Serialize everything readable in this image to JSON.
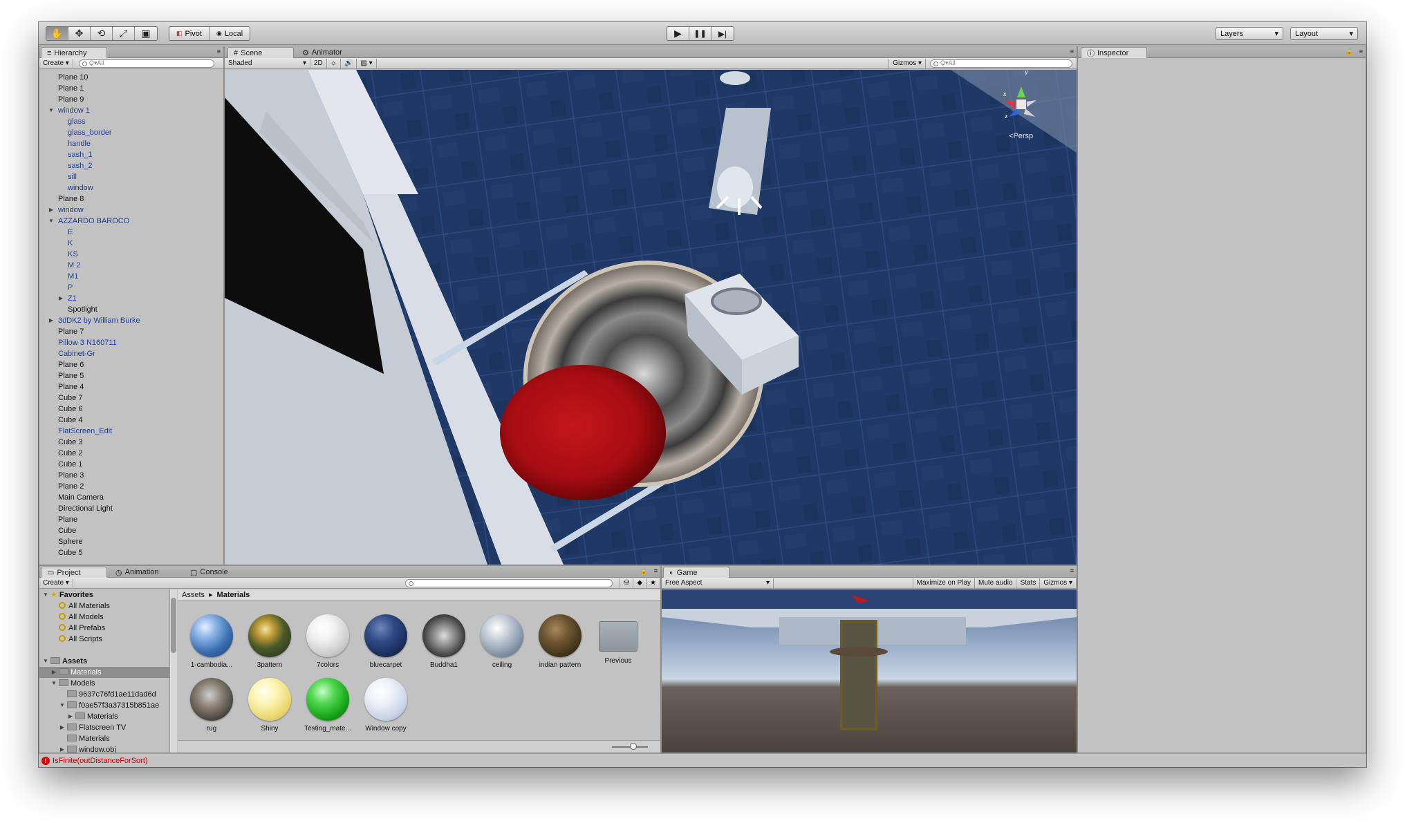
{
  "toolbar": {
    "transform_tools": [
      "hand-tool-icon",
      "move-tool-icon",
      "rotate-tool-icon",
      "scale-tool-icon",
      "rect-tool-icon"
    ],
    "pivot_label": "Pivot",
    "local_label": "Local",
    "play": "▶",
    "pause": "❚❚",
    "step": "▶|",
    "layers_label": "Layers",
    "layout_label": "Layout"
  },
  "hierarchy": {
    "tab": "Hierarchy",
    "create": "Create",
    "search_placeholder": "Q▾All",
    "items": [
      {
        "label": "Plane 10",
        "indent": 0,
        "prefab": false,
        "fold": ""
      },
      {
        "label": "Plane 1",
        "indent": 0,
        "prefab": false,
        "fold": ""
      },
      {
        "label": "Plane 9",
        "indent": 0,
        "prefab": false,
        "fold": ""
      },
      {
        "label": "window 1",
        "indent": 0,
        "prefab": true,
        "fold": "open"
      },
      {
        "label": "glass",
        "indent": 1,
        "prefab": true,
        "fold": ""
      },
      {
        "label": "glass_border",
        "indent": 1,
        "prefab": true,
        "fold": ""
      },
      {
        "label": "handle",
        "indent": 1,
        "prefab": true,
        "fold": ""
      },
      {
        "label": "sash_1",
        "indent": 1,
        "prefab": true,
        "fold": ""
      },
      {
        "label": "sash_2",
        "indent": 1,
        "prefab": true,
        "fold": ""
      },
      {
        "label": "sill",
        "indent": 1,
        "prefab": true,
        "fold": ""
      },
      {
        "label": "window",
        "indent": 1,
        "prefab": true,
        "fold": ""
      },
      {
        "label": "Plane 8",
        "indent": 0,
        "prefab": false,
        "fold": ""
      },
      {
        "label": "window",
        "indent": 0,
        "prefab": true,
        "fold": "closed"
      },
      {
        "label": "AZZARDO BAROCO",
        "indent": 0,
        "prefab": true,
        "fold": "open"
      },
      {
        "label": "E",
        "indent": 1,
        "prefab": true,
        "fold": ""
      },
      {
        "label": "K",
        "indent": 1,
        "prefab": true,
        "fold": ""
      },
      {
        "label": "KS",
        "indent": 1,
        "prefab": true,
        "fold": ""
      },
      {
        "label": "M 2",
        "indent": 1,
        "prefab": true,
        "fold": ""
      },
      {
        "label": "M1",
        "indent": 1,
        "prefab": true,
        "fold": ""
      },
      {
        "label": "P",
        "indent": 1,
        "prefab": true,
        "fold": ""
      },
      {
        "label": "Z1",
        "indent": 1,
        "prefab": true,
        "fold": "closed"
      },
      {
        "label": "Spotlight",
        "indent": 1,
        "prefab": false,
        "fold": ""
      },
      {
        "label": "3dDK2 by William Burke",
        "indent": 0,
        "prefab": true,
        "fold": "closed"
      },
      {
        "label": "Plane 7",
        "indent": 0,
        "prefab": false,
        "fold": ""
      },
      {
        "label": "Pillow 3 N160711",
        "indent": 0,
        "prefab": true,
        "fold": ""
      },
      {
        "label": "Cabinet-Gr",
        "indent": 0,
        "prefab": true,
        "fold": ""
      },
      {
        "label": "Plane 6",
        "indent": 0,
        "prefab": false,
        "fold": ""
      },
      {
        "label": "Plane 5",
        "indent": 0,
        "prefab": false,
        "fold": ""
      },
      {
        "label": "Plane 4",
        "indent": 0,
        "prefab": false,
        "fold": ""
      },
      {
        "label": "Cube 7",
        "indent": 0,
        "prefab": false,
        "fold": ""
      },
      {
        "label": "Cube 6",
        "indent": 0,
        "prefab": false,
        "fold": ""
      },
      {
        "label": "Cube 4",
        "indent": 0,
        "prefab": false,
        "fold": ""
      },
      {
        "label": "FlatScreen_Edit",
        "indent": 0,
        "prefab": true,
        "fold": ""
      },
      {
        "label": "Cube 3",
        "indent": 0,
        "prefab": false,
        "fold": ""
      },
      {
        "label": "Cube 2",
        "indent": 0,
        "prefab": false,
        "fold": ""
      },
      {
        "label": "Cube 1",
        "indent": 0,
        "prefab": false,
        "fold": ""
      },
      {
        "label": "Plane 3",
        "indent": 0,
        "prefab": false,
        "fold": ""
      },
      {
        "label": "Plane 2",
        "indent": 0,
        "prefab": false,
        "fold": ""
      },
      {
        "label": "Main Camera",
        "indent": 0,
        "prefab": false,
        "fold": ""
      },
      {
        "label": "Directional Light",
        "indent": 0,
        "prefab": false,
        "fold": ""
      },
      {
        "label": "Plane",
        "indent": 0,
        "prefab": false,
        "fold": ""
      },
      {
        "label": "Cube",
        "indent": 0,
        "prefab": false,
        "fold": ""
      },
      {
        "label": "Sphere",
        "indent": 0,
        "prefab": false,
        "fold": ""
      },
      {
        "label": "Cube 5",
        "indent": 0,
        "prefab": false,
        "fold": ""
      }
    ]
  },
  "scene": {
    "tab_scene": "Scene",
    "tab_animator": "Animator",
    "shading": "Shaded",
    "mode_2d": "2D",
    "gizmos": "Gizmos",
    "search_placeholder": "Q▾All",
    "persp": "Persp",
    "axis_y": "y",
    "axis_x": "x",
    "axis_z": "z"
  },
  "inspector": {
    "tab": "Inspector"
  },
  "project": {
    "tab_project": "Project",
    "tab_animation": "Animation",
    "tab_console": "Console",
    "create": "Create",
    "breadcrumb_root": "Assets",
    "breadcrumb_sep": "▸",
    "breadcrumb_current": "Materials",
    "tree": [
      {
        "label": "Favorites",
        "kind": "fav-root",
        "indent": 0,
        "fold": "open",
        "sel": false
      },
      {
        "label": "All Materials",
        "kind": "search",
        "indent": 1,
        "fold": "",
        "sel": false
      },
      {
        "label": "All Models",
        "kind": "search",
        "indent": 1,
        "fold": "",
        "sel": false
      },
      {
        "label": "All Prefabs",
        "kind": "search",
        "indent": 1,
        "fold": "",
        "sel": false
      },
      {
        "label": "All Scripts",
        "kind": "search",
        "indent": 1,
        "fold": "",
        "sel": false
      },
      {
        "label": "",
        "kind": "spacer",
        "indent": 0,
        "fold": "",
        "sel": false
      },
      {
        "label": "Assets",
        "kind": "root",
        "indent": 0,
        "fold": "open",
        "sel": false
      },
      {
        "label": "Materials",
        "kind": "folder",
        "indent": 1,
        "fold": "closed",
        "sel": true
      },
      {
        "label": "Models",
        "kind": "folder",
        "indent": 1,
        "fold": "open",
        "sel": false
      },
      {
        "label": "9637c76fd1ae11dad6d",
        "kind": "folder",
        "indent": 2,
        "fold": "",
        "sel": false
      },
      {
        "label": "f0ae57f3a37315b851ae",
        "kind": "folder",
        "indent": 2,
        "fold": "open",
        "sel": false
      },
      {
        "label": "Materials",
        "kind": "folder",
        "indent": 3,
        "fold": "closed",
        "sel": false
      },
      {
        "label": "Flatscreen TV",
        "kind": "folder",
        "indent": 2,
        "fold": "closed",
        "sel": false
      },
      {
        "label": "Materials",
        "kind": "folder",
        "indent": 2,
        "fold": "",
        "sel": false
      },
      {
        "label": "window.obj",
        "kind": "folder",
        "indent": 2,
        "fold": "closed",
        "sel": false
      }
    ],
    "assets": [
      {
        "label": "1-cambodia...",
        "bg": "radial-gradient(circle at 35% 30%,#e8f2ff 0,#8fb6e8 25%,#3a6fb0 60%,#163a70 100%)"
      },
      {
        "label": "3pattern",
        "bg": "radial-gradient(circle at 40% 35%,#f2e29a 0,#b79434 25%,#4b5a2a 50%,#1e2a1a 100%)"
      },
      {
        "label": "7colors",
        "bg": "radial-gradient(circle at 38% 32%,#ffffff 0,#f2f2f2 30%,#c9c9c9 70%,#8f8f8f 100%)"
      },
      {
        "label": "bluecarpet",
        "bg": "radial-gradient(circle at 38% 32%,#6f86b8 0,#2f4a86 35%,#1a2d5a 70%,#0b1430 100%)"
      },
      {
        "label": "Buddha1",
        "bg": "radial-gradient(circle at 50% 50%,#dcdcdc 0,#8a8a8a 35%,#3a3a3a 70%,#101010 100%)"
      },
      {
        "label": "ceiling",
        "bg": "radial-gradient(circle at 38% 32%,#ffffff 0,#c6cfd9 30%,#7f8fa1 70%,#4c5a6b 100%)"
      },
      {
        "label": "indian pattern",
        "bg": "radial-gradient(circle at 40% 35%,#a68a5a 0,#6d5532 35%,#3b2d18 75%,#1c140a 100%)"
      },
      {
        "label": "Previous",
        "bg": ""
      },
      {
        "label": "rug",
        "bg": "radial-gradient(circle at 45% 40%,#cfcfcf 0,#8c8276 35%,#4b4640 70%,#1f1d1a 100%)"
      },
      {
        "label": "Shiny",
        "bg": "radial-gradient(circle at 38% 32%,#ffffee 0,#fff5b8 30%,#e8d66a 70%,#b9a53a 100%)"
      },
      {
        "label": "Testing_mate...",
        "bg": "radial-gradient(circle at 38% 32%,#c8ffc8 0,#52d652 30%,#17a617 65%,#0b5e0b 100%)"
      },
      {
        "label": "Window copy",
        "bg": "radial-gradient(circle at 38% 32%,#ffffff 0,#eef2fa 30%,#c7d2e6 70%,#8f9db8 100%)"
      }
    ]
  },
  "game": {
    "tab": "Game",
    "aspect": "Free Aspect",
    "maximize": "Maximize on Play",
    "mute": "Mute audio",
    "stats": "Stats",
    "gizmos": "Gizmos"
  },
  "status": {
    "error_text": "IsFinite(outDistanceForSort)"
  },
  "colors": {
    "prefab": "#1b3fa0",
    "error": "#c00000",
    "selection": "#8e8e8e"
  }
}
